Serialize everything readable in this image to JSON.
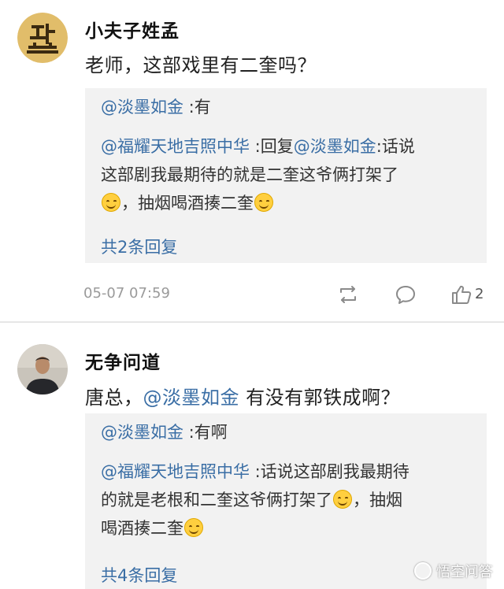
{
  "comments": [
    {
      "username": "小夫子姓孟",
      "text": "老师，这部戏里有二奎吗？",
      "replies": {
        "r1_mention": "@淡墨如金",
        "r1_text": " :有",
        "r2_mention1": "@福耀天地吉照中华",
        "r2_text1": " :回复",
        "r2_mention2": "@淡墨如金",
        "r2_text2": ":话说",
        "r2_line2": "这部剧我最期待的就是二奎这爷俩打架了",
        "r2_line3": "，抽烟喝酒揍二奎",
        "more": "共2条回复"
      },
      "timestamp": "05-07 07:59",
      "like_count": "2"
    },
    {
      "username": "无争问道",
      "text_prefix": "唐总，",
      "text_mention": "@淡墨如金",
      "text_suffix": " 有没有郭铁成啊？",
      "replies": {
        "r1_mention": "@淡墨如金",
        "r1_text": " :有啊",
        "r2_mention": "@福耀天地吉照中华",
        "r2_text1": " :话说这部剧我最期待",
        "r2_line2": "的就是老根和二奎这爷俩打架了",
        "r2_line2b": "，抽烟",
        "r2_line3": "喝酒揍二奎",
        "more": "共4条回复"
      }
    }
  ],
  "watermark": {
    "label": "悟空问答"
  },
  "colors": {
    "mention": "#3a6ea5",
    "reply_bg": "#f2f2f2",
    "meta": "#9a9a9a"
  },
  "icons": [
    "seal-avatar-icon",
    "person-avatar-icon",
    "repost-icon",
    "comment-icon",
    "thumbs-up-icon",
    "smile-emoji-icon",
    "grin-emoji-icon",
    "wukong-logo-icon"
  ]
}
